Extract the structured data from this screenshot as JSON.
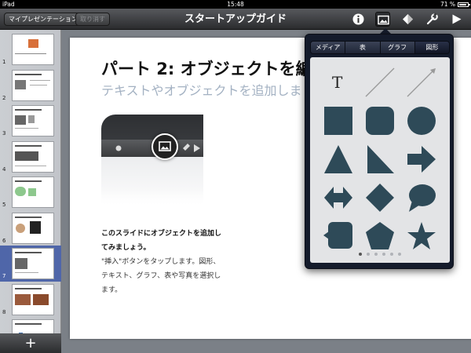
{
  "status_bar": {
    "device": "iPad",
    "time": "15:48",
    "battery": "71 %",
    "battery_level": 0.71
  },
  "toolbar": {
    "my_presentations": "マイプレゼンテーション",
    "undo": "取り消す",
    "title": "スタートアップガイド",
    "icons": [
      "info-icon",
      "media-icon",
      "tools-icon",
      "wrench-icon",
      "play-icon"
    ]
  },
  "sidebar": {
    "slides": [
      {
        "number": "1"
      },
      {
        "number": "2"
      },
      {
        "number": "3"
      },
      {
        "number": "4"
      },
      {
        "number": "5"
      },
      {
        "number": "6"
      },
      {
        "number": "7"
      },
      {
        "number": "8"
      },
      {
        "number": ""
      }
    ],
    "selected": 7,
    "add_label": "+"
  },
  "slide": {
    "title": "パート 2: オブジェクトを編集",
    "subtitle": "テキストやオブジェクトを追加しま",
    "body_bold": "このスライドにオブジェクトを追加してみましょう。",
    "body_text": "\"挿入\"ボタンをタップします。図形、テキスト、グラフ、表や写真を選択します。"
  },
  "popover": {
    "tabs": [
      "メディア",
      "表",
      "グラフ",
      "図形"
    ],
    "selected_tab": "図形",
    "text_tool": "T",
    "shapes": [
      "text-shape",
      "line-shape",
      "arrow-line-shape",
      "square-shape",
      "rounded-square-shape",
      "circle-shape",
      "triangle-shape",
      "right-triangle-shape",
      "arrow-shape",
      "double-arrow-shape",
      "diamond-shape",
      "speech-bubble-shape",
      "callout-square-shape",
      "pentagon-shape",
      "star-shape"
    ],
    "shape_color": "#2e4a58",
    "pages": 6,
    "current_page": 1
  }
}
